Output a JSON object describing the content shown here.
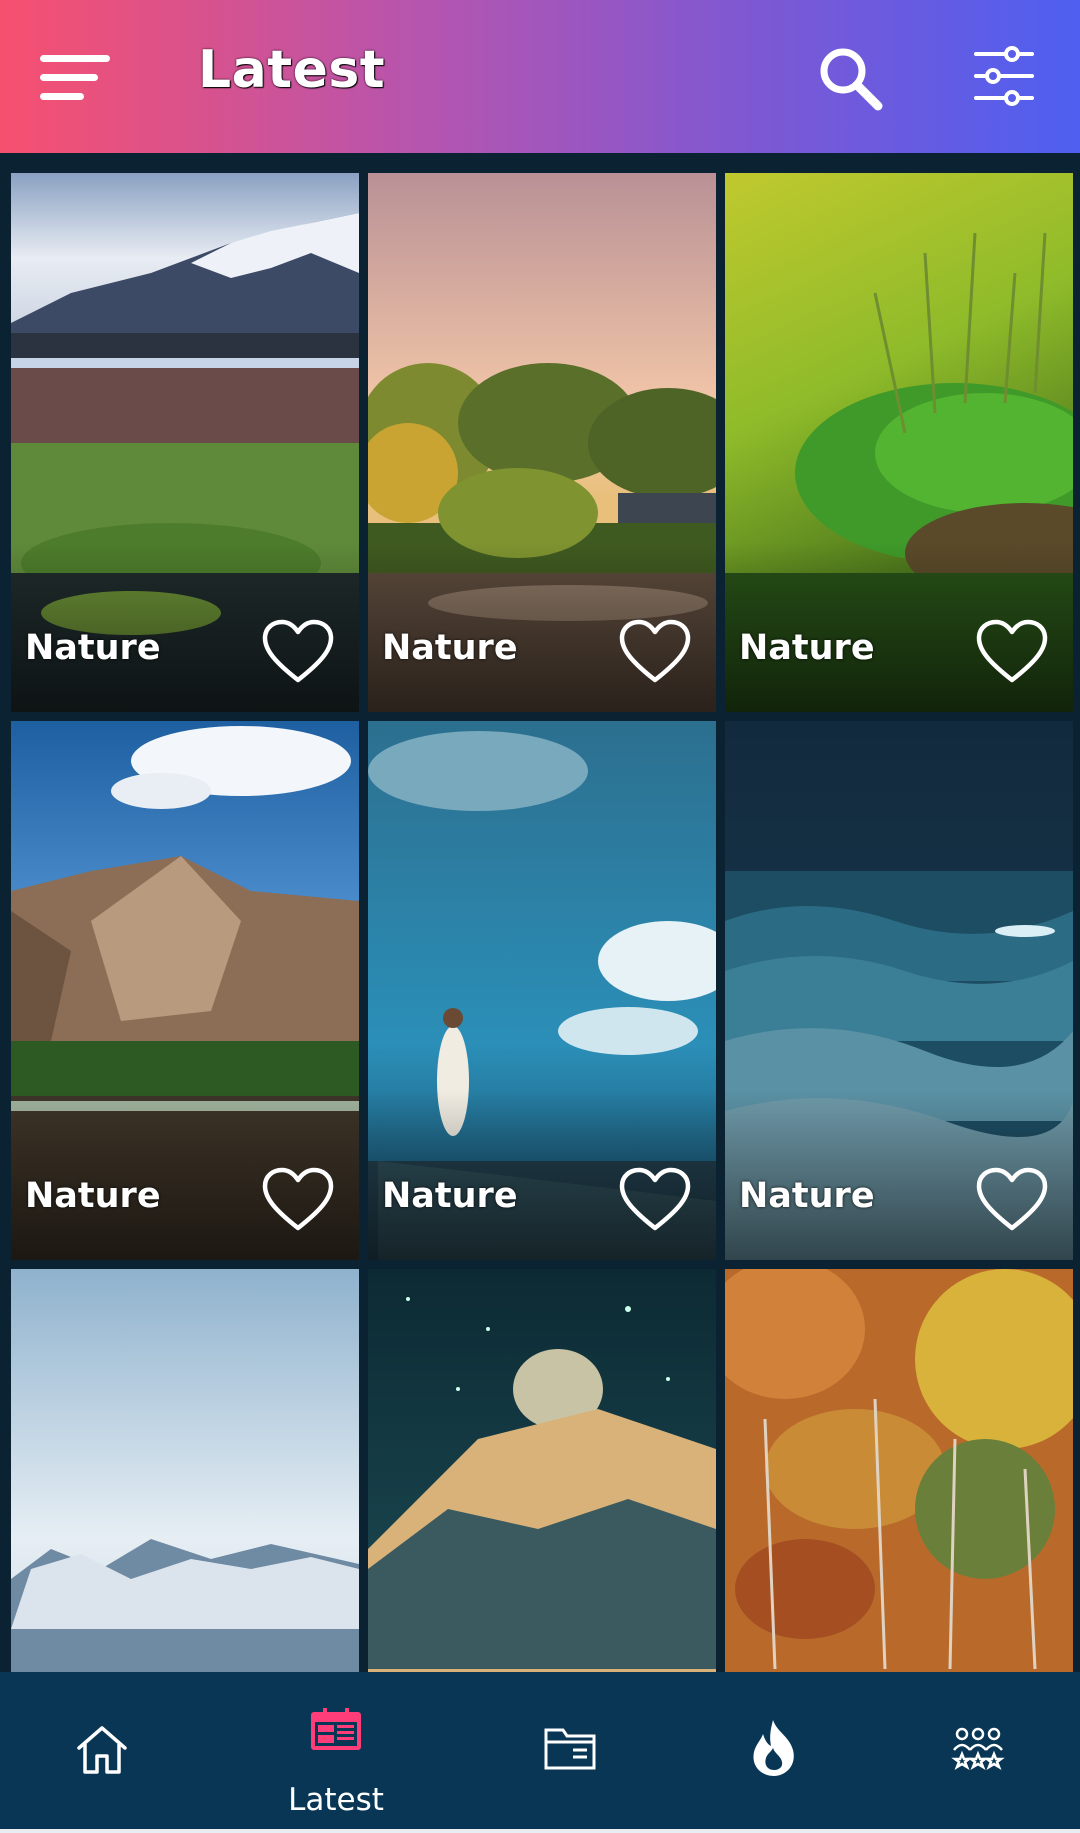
{
  "header": {
    "title": "Latest",
    "menu_icon": "menu-icon",
    "search_icon": "search-icon",
    "filter_icon": "sliders-icon",
    "gradient_colors": [
      "#f7506f",
      "#b455b0",
      "#7d58d3",
      "#4f5ff0"
    ]
  },
  "grid": {
    "tiles": [
      {
        "label": "Nature",
        "scene": "mountain-marsh",
        "favorite": false
      },
      {
        "label": "Nature",
        "scene": "sunset-garden",
        "favorite": false
      },
      {
        "label": "Nature",
        "scene": "green-moss",
        "favorite": false
      },
      {
        "label": "Nature",
        "scene": "brown-mountain",
        "favorite": false
      },
      {
        "label": "Nature",
        "scene": "sky-girl",
        "favorite": false
      },
      {
        "label": "Nature",
        "scene": "ocean-waves",
        "favorite": false
      },
      {
        "label": "",
        "scene": "snowy-peaks",
        "favorite": false
      },
      {
        "label": "",
        "scene": "starry-volcano",
        "favorite": false
      },
      {
        "label": "",
        "scene": "autumn-forest",
        "favorite": false
      }
    ]
  },
  "bottom_nav": {
    "items": [
      {
        "name": "home",
        "icon": "home-icon",
        "label": "",
        "active": false
      },
      {
        "name": "latest",
        "icon": "calendar-icon",
        "label": "Latest",
        "active": true
      },
      {
        "name": "categories",
        "icon": "folder-icon",
        "label": "",
        "active": false
      },
      {
        "name": "popular",
        "icon": "fire-icon",
        "label": "",
        "active": false
      },
      {
        "name": "featured",
        "icon": "users-stars-icon",
        "label": "",
        "active": false
      }
    ],
    "active_color": "#ff3d78",
    "background": "#083654"
  }
}
